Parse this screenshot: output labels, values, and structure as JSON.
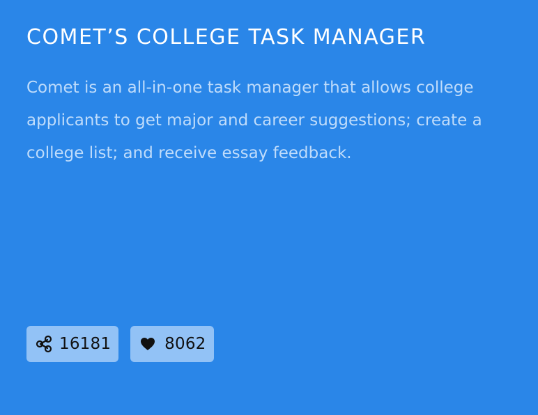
{
  "card": {
    "title": "COMET’S COLLEGE TASK MANAGER",
    "description": "Comet is an all-in-one task manager that allows college applicants to get major and career suggestions; create a college list; and receive essay feedback."
  },
  "stats": {
    "shares": {
      "icon": "share-icon",
      "count": "16181"
    },
    "likes": {
      "icon": "heart-icon",
      "count": "8062"
    }
  },
  "colors": {
    "background": "#2a86e8",
    "title": "#ffffff",
    "description": "#bfdcfb",
    "stat_button_bg": "#92c2f6",
    "stat_text": "#111111"
  }
}
